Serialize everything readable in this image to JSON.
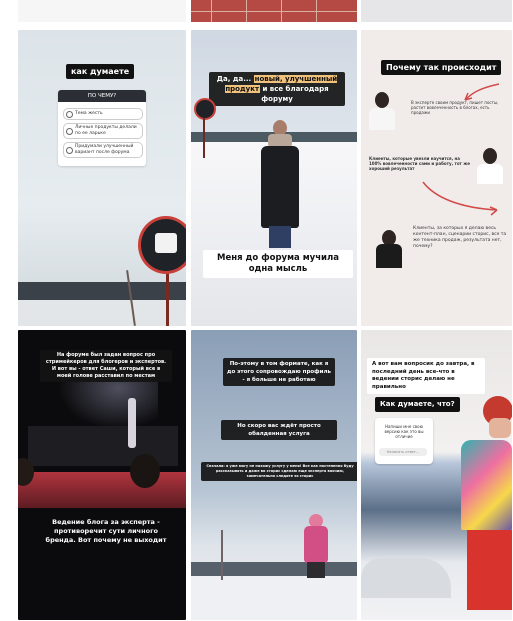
{
  "tiles": [
    {
      "name": "story-1",
      "title": "как думаете",
      "poll": {
        "question": "ПО ЧЕМУ?",
        "options": [
          "Тема жесть",
          "Личные продукты делали по ее ларьке",
          "Придумали улучшенный вариант после форума"
        ]
      }
    },
    {
      "name": "story-2",
      "caption_top_1": "Да, да... ",
      "caption_top_hl": "новый, улучшенный продукт",
      "caption_top_2": " и все благодаря форуму",
      "caption_bottom": "Меня до форума мучила одна мысль"
    },
    {
      "name": "story-3",
      "title": "Почему так происходит",
      "note_1": "В эксперте своим продукт, пишет посты, растит вовлеченность в блогах, есть продажи",
      "note_2": "Клиенты, которые увезли научится, на 100% вовлеченности сами и работу, тот же хороший результат",
      "note_3": "Клиенты, за которых я делаю весь контент-план, сценарии сторис, все та же техника продаж, результата нет, почему?"
    },
    {
      "name": "story-4",
      "caption_top": "На форуме был задан вопрос про стримейкеров для блогеров и экспертов. И вот вы - ответ Саши, который все в моей голове расставил по местам",
      "caption_bottom": "Ведение блога за эксперта - противоречит сути личного бренда. Вот почему не выходит"
    },
    {
      "name": "story-5",
      "caption_1": "По-этому в том формате, как я до этого сопровождаю профиль - я больше не работаю",
      "caption_2": "Но скоро вас ждёт просто обалденная услуга",
      "caption_3": "Сначала: я уже могу не нахожу услугу у меня! Все как постепенно буду рассказывать и даже во сторис сделаю еще эксперта воочию, замечательно следите за сторис"
    },
    {
      "name": "story-6",
      "caption_top": "А вот вам вопросик до завтра, в последний день все-что в ведении сторис делаю не правильно",
      "question": "Как думаете, что?",
      "answer_box": "Напиши мне свою версию как это вы отличие",
      "input_placeholder": "Написать ответ..."
    }
  ]
}
